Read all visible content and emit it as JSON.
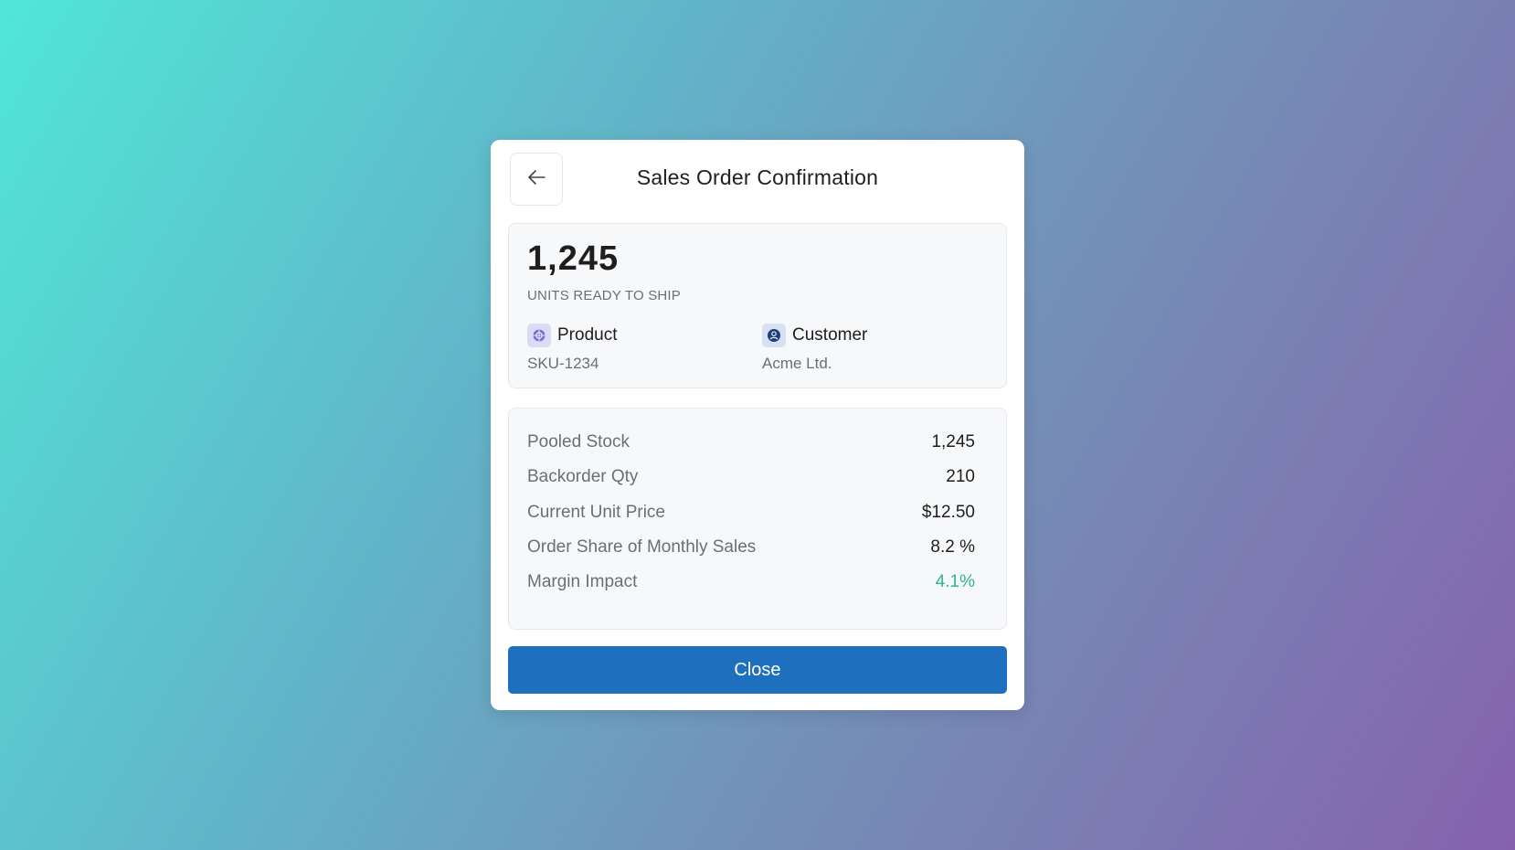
{
  "dialog": {
    "title": "Sales Order Confirmation",
    "back_icon": "arrow-left-icon"
  },
  "summary": {
    "units": "1,245",
    "units_label": "UNITS READY TO SHIP",
    "product": {
      "title": "Product",
      "value": "SKU-1234",
      "icon": "product-icon"
    },
    "customer": {
      "title": "Customer",
      "value": "Acme Ltd.",
      "icon": "customer-icon"
    }
  },
  "details": [
    {
      "label": "Pooled Stock",
      "value": "1,245"
    },
    {
      "label": "Backorder Qty",
      "value": "210"
    },
    {
      "label": "Current Unit Price",
      "value": "$12.50"
    },
    {
      "label": "Order Share of Monthly Sales",
      "value": "8.2 %"
    },
    {
      "label": "Margin Impact",
      "value": "4.1%",
      "color": "#2fb58f"
    }
  ],
  "actions": {
    "close_label": "Close",
    "close_color": "#1e6fbd"
  }
}
